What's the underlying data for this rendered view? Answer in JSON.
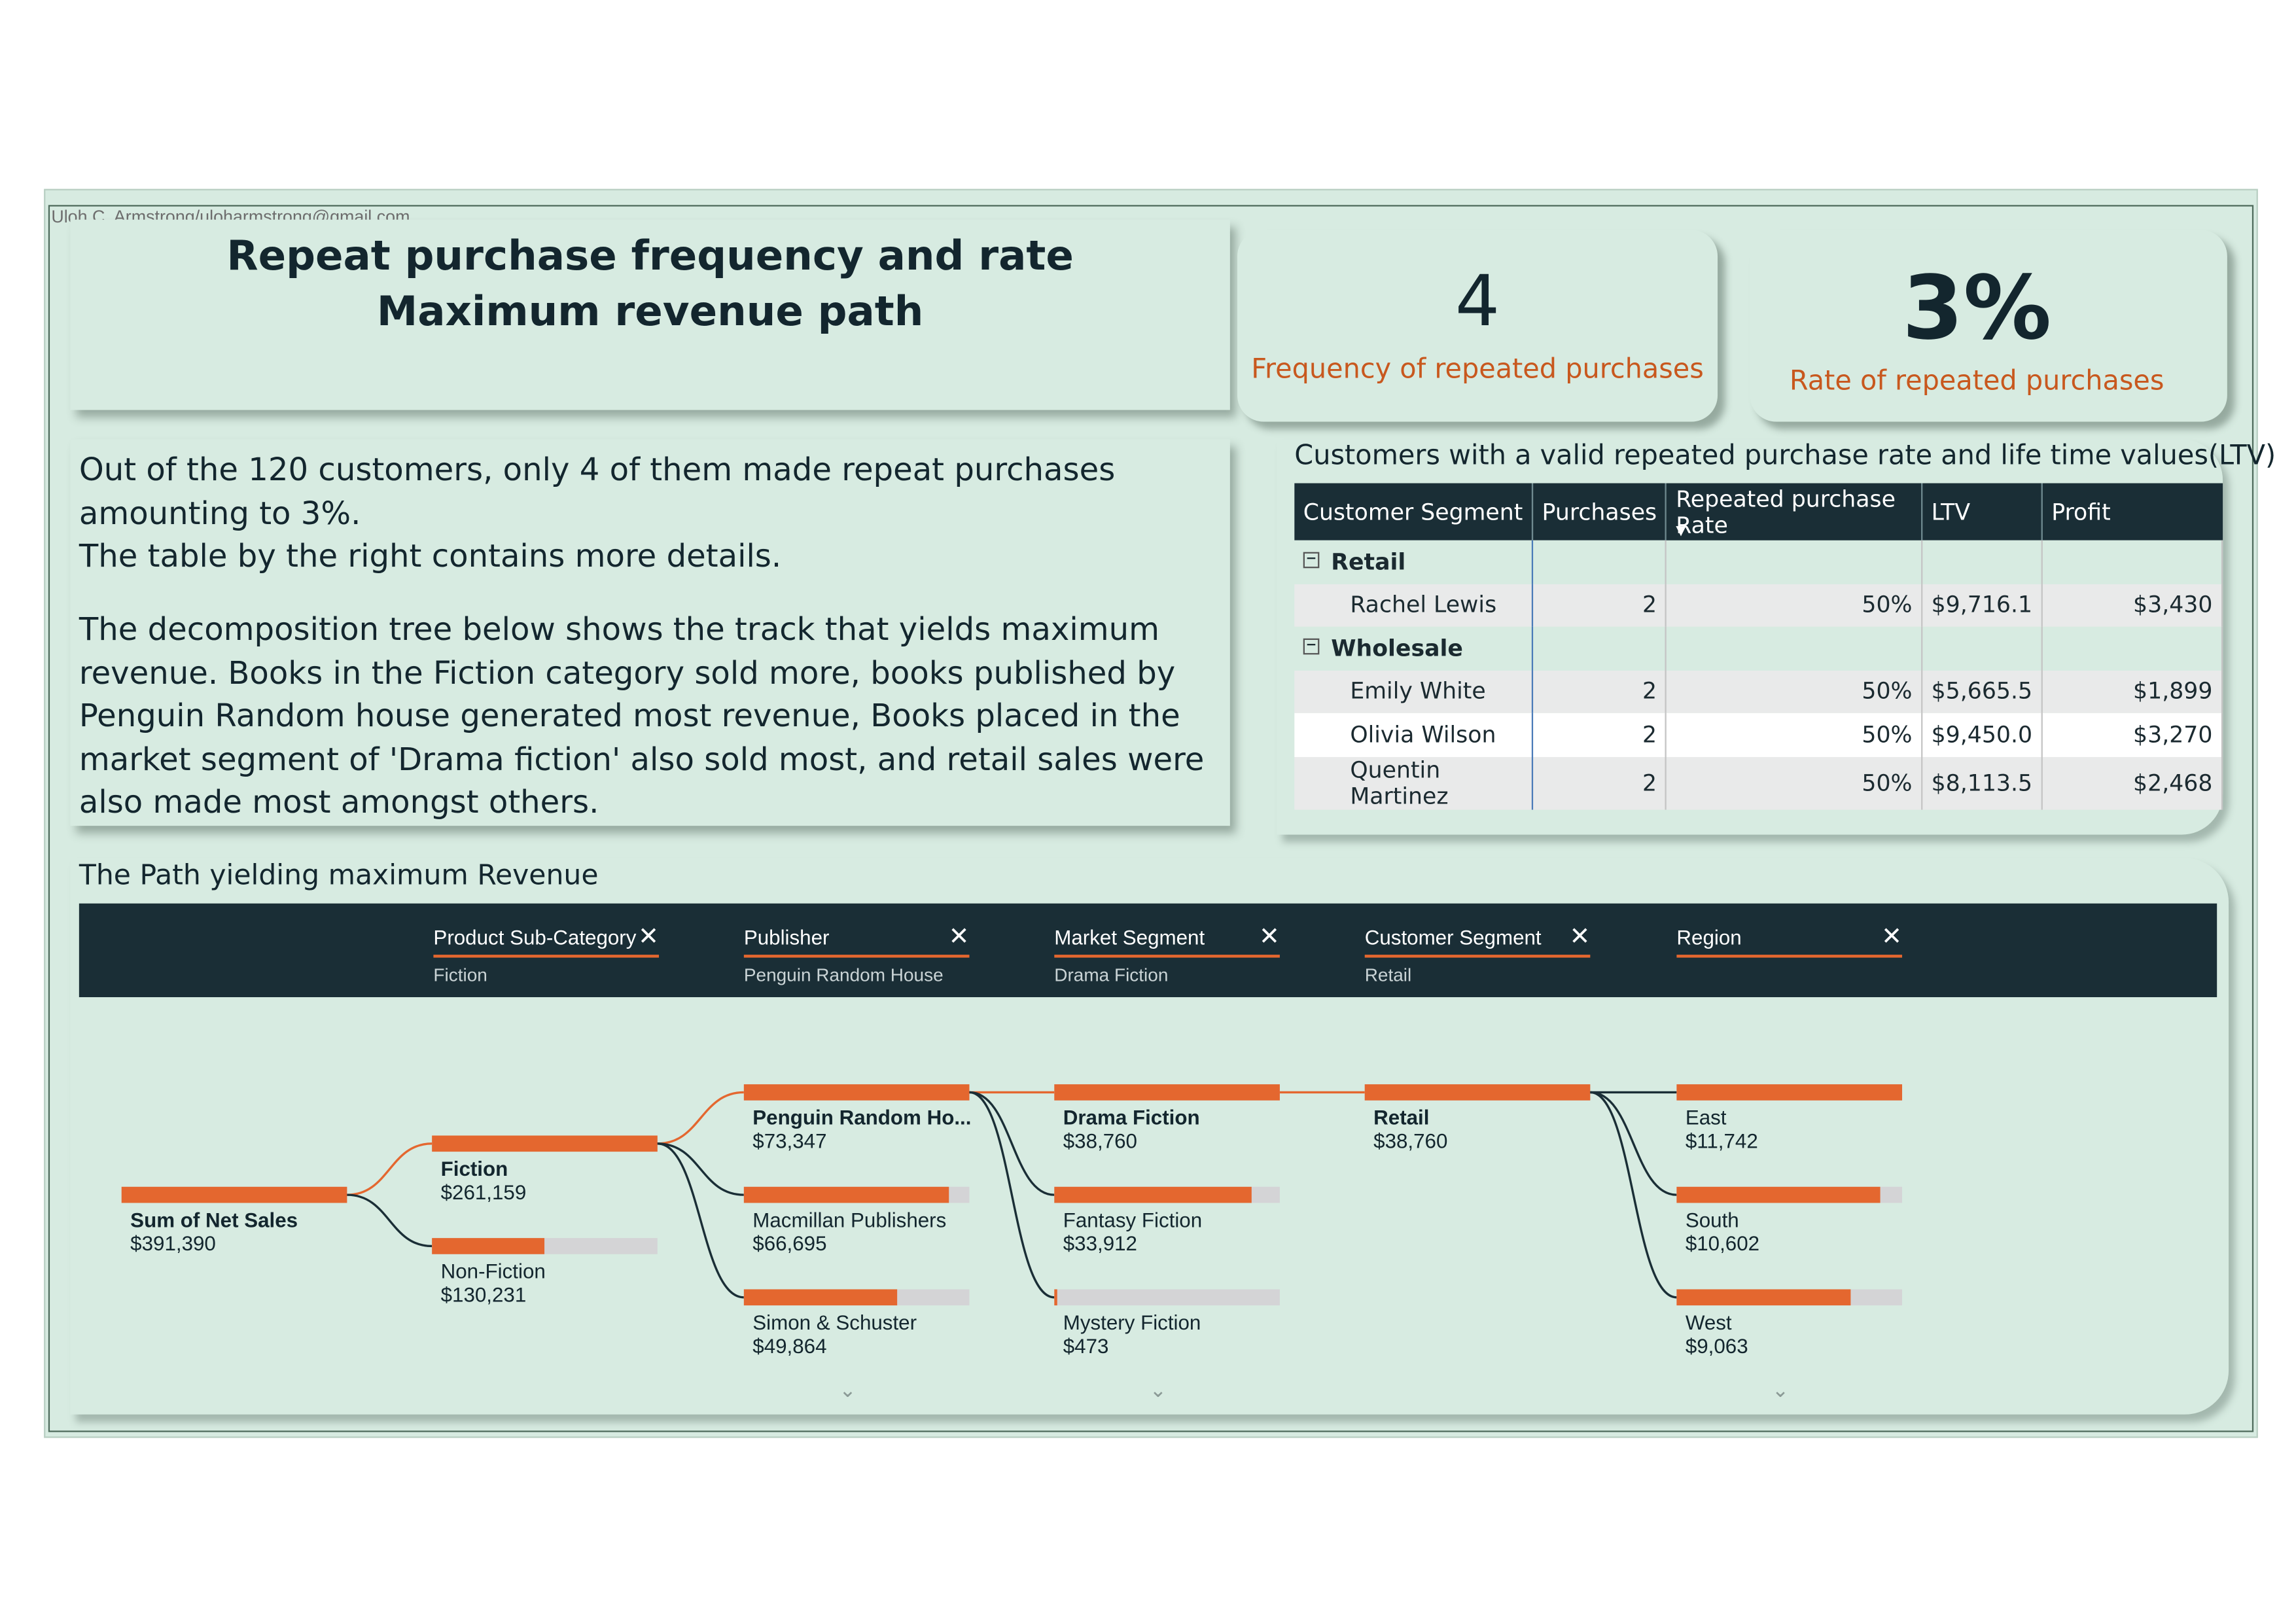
{
  "author": "Uloh C. Armstrong/uloharmstrong@gmail.com",
  "title": {
    "line1": "Repeat purchase frequency and rate",
    "line2": "Maximum revenue path"
  },
  "summary": {
    "p1": "Out of the 120 customers, only 4 of them made repeat purchases amounting to 3%.",
    "p2": "The table by the right contains more details.",
    "p3": "The decomposition tree below shows the track that yields maximum revenue. Books in the Fiction category sold more, books published by Penguin Random house generated most revenue, Books placed in the market segment of 'Drama fiction' also sold most, and retail sales were also made most amongst others."
  },
  "kpis": [
    {
      "value": "4",
      "label": "Frequency of repeated purchases"
    },
    {
      "value": "3%",
      "label": "Rate of repeated purchases"
    }
  ],
  "table": {
    "title": "Customers with a valid repeated purchase rate and life time values(LTV)",
    "headers": [
      "Customer Segment",
      "Purchases",
      "Repeated purchase Rate",
      "LTV",
      "Profit"
    ],
    "groups": [
      {
        "segment": "Retail",
        "rows": [
          {
            "name": "Rachel Lewis",
            "purchases": "2",
            "rate": "50%",
            "ltv": "$9,716.1",
            "profit": "$3,430"
          }
        ]
      },
      {
        "segment": "Wholesale",
        "rows": [
          {
            "name": "Emily White",
            "purchases": "2",
            "rate": "50%",
            "ltv": "$5,665.5",
            "profit": "$1,899"
          },
          {
            "name": "Olivia Wilson",
            "purchases": "2",
            "rate": "50%",
            "ltv": "$9,450.0",
            "profit": "$3,270"
          },
          {
            "name": "Quentin Martinez",
            "purchases": "2",
            "rate": "50%",
            "ltv": "$8,113.5",
            "profit": "$2,468"
          }
        ]
      }
    ]
  },
  "tree": {
    "title": "The Path yielding maximum Revenue",
    "filters": [
      {
        "name": "Product Sub-Category",
        "value": "Fiction"
      },
      {
        "name": "Publisher",
        "value": "Penguin Random House"
      },
      {
        "name": "Market Segment",
        "value": "Drama Fiction"
      },
      {
        "name": "Customer Segment",
        "value": "Retail"
      },
      {
        "name": "Region",
        "value": ""
      }
    ],
    "root": {
      "label": "Sum of Net Sales",
      "value": "$391,390",
      "amount": 391390
    },
    "levels": [
      [
        {
          "label": "Fiction",
          "value": "$261,159",
          "amount": 261159,
          "selected": true
        },
        {
          "label": "Non-Fiction",
          "value": "$130,231",
          "amount": 130231,
          "selected": false
        }
      ],
      [
        {
          "label": "Penguin Random Ho...",
          "value": "$73,347",
          "amount": 73347,
          "selected": true
        },
        {
          "label": "Macmillan Publishers",
          "value": "$66,695",
          "amount": 66695,
          "selected": false
        },
        {
          "label": "Simon & Schuster",
          "value": "$49,864",
          "amount": 49864,
          "selected": false
        }
      ],
      [
        {
          "label": "Drama Fiction",
          "value": "$38,760",
          "amount": 38760,
          "selected": true
        },
        {
          "label": "Fantasy Fiction",
          "value": "$33,912",
          "amount": 33912,
          "selected": false
        },
        {
          "label": "Mystery Fiction",
          "value": "$473",
          "amount": 473,
          "selected": false
        }
      ],
      [
        {
          "label": "Retail",
          "value": "$38,760",
          "amount": 38760,
          "selected": true
        }
      ],
      [
        {
          "label": "East",
          "value": "$11,742",
          "amount": 11742,
          "selected": false
        },
        {
          "label": "South",
          "value": "$10,602",
          "amount": 10602,
          "selected": false
        },
        {
          "label": "West",
          "value": "$9,063",
          "amount": 9063,
          "selected": false
        }
      ]
    ],
    "colors": {
      "bar": "#e4672f",
      "track": "#d4d4d6",
      "path": "#e4672f",
      "link": "#1a2e36"
    }
  }
}
